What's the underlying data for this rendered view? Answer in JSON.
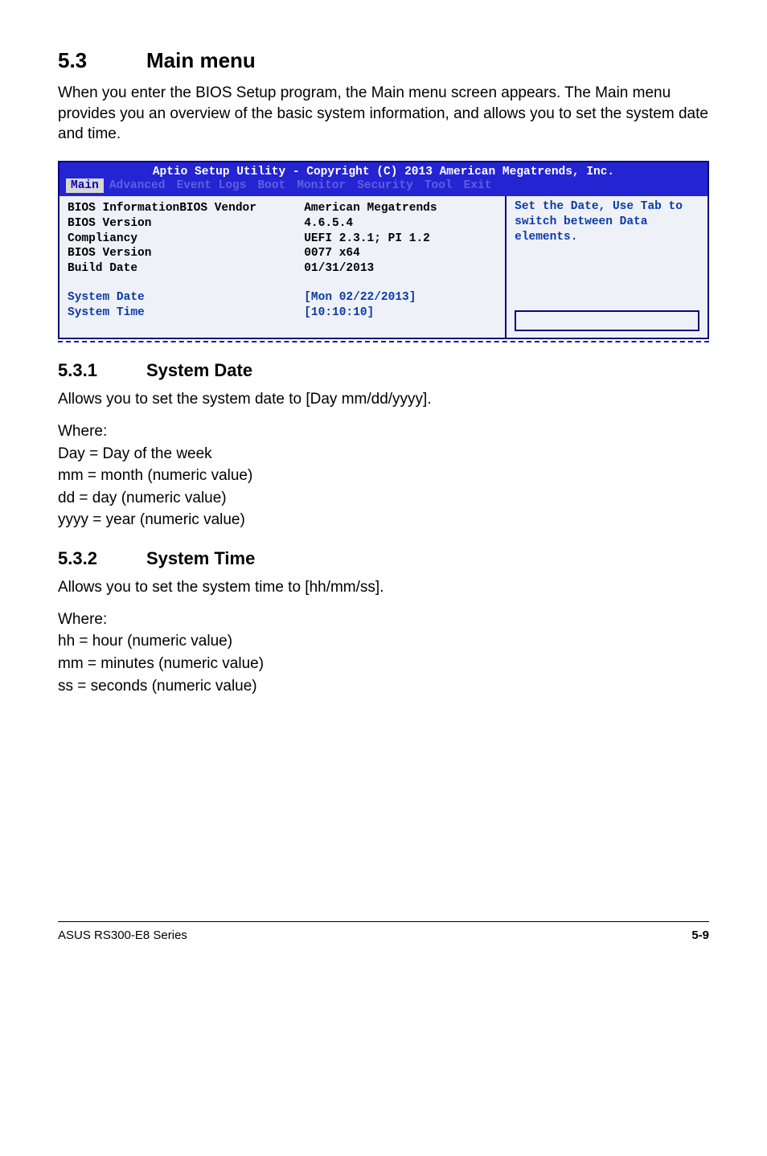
{
  "heading": {
    "num": "5.3",
    "title": "Main menu"
  },
  "intro": "When you enter the BIOS Setup program, the Main menu screen appears. The Main menu provides you an overview of the basic system information, and allows you to set the system date and time.",
  "bios": {
    "title": "Aptio Setup Utility - Copyright (C) 2013 American Megatrends, Inc.",
    "tabs": [
      "Main",
      "Advanced",
      "Event Logs",
      "Boot",
      "Monitor",
      "Security",
      "Tool",
      "Exit"
    ],
    "active_tab": "Main",
    "rows": [
      {
        "label": "BIOS InformationBIOS Vendor",
        "value": "American Megatrends"
      },
      {
        "label": "BIOS Version",
        "value": "4.6.5.4"
      },
      {
        "label": "Compliancy",
        "value": "UEFI 2.3.1; PI 1.2"
      },
      {
        "label": "BIOS Version",
        "value": "0077 x64"
      },
      {
        "label": "Build Date",
        "value": "01/31/2013"
      }
    ],
    "selectable": {
      "date_label": "System Date",
      "date_value": "[Mon 02/22/2013]",
      "time_label": "System Time",
      "time_value": "[10:10:10]"
    },
    "help_text": "Set the Date, Use Tab to switch between Data elements."
  },
  "sub1": {
    "num": "5.3.1",
    "title": "System Date",
    "desc": "Allows you to set the system date to [Day mm/dd/yyyy].",
    "where": "Where:",
    "lines": [
      "Day = Day of the week",
      "mm = month (numeric value)",
      "dd = day (numeric value)",
      "yyyy = year (numeric value)"
    ]
  },
  "sub2": {
    "num": "5.3.2",
    "title": "System Time",
    "desc": "Allows you to set the system time to [hh/mm/ss].",
    "where": "Where:",
    "lines": [
      "hh = hour (numeric value)",
      "mm = minutes (numeric value)",
      "ss = seconds (numeric value)"
    ]
  },
  "footer": {
    "left": "ASUS RS300-E8 Series",
    "right": "5-9"
  }
}
